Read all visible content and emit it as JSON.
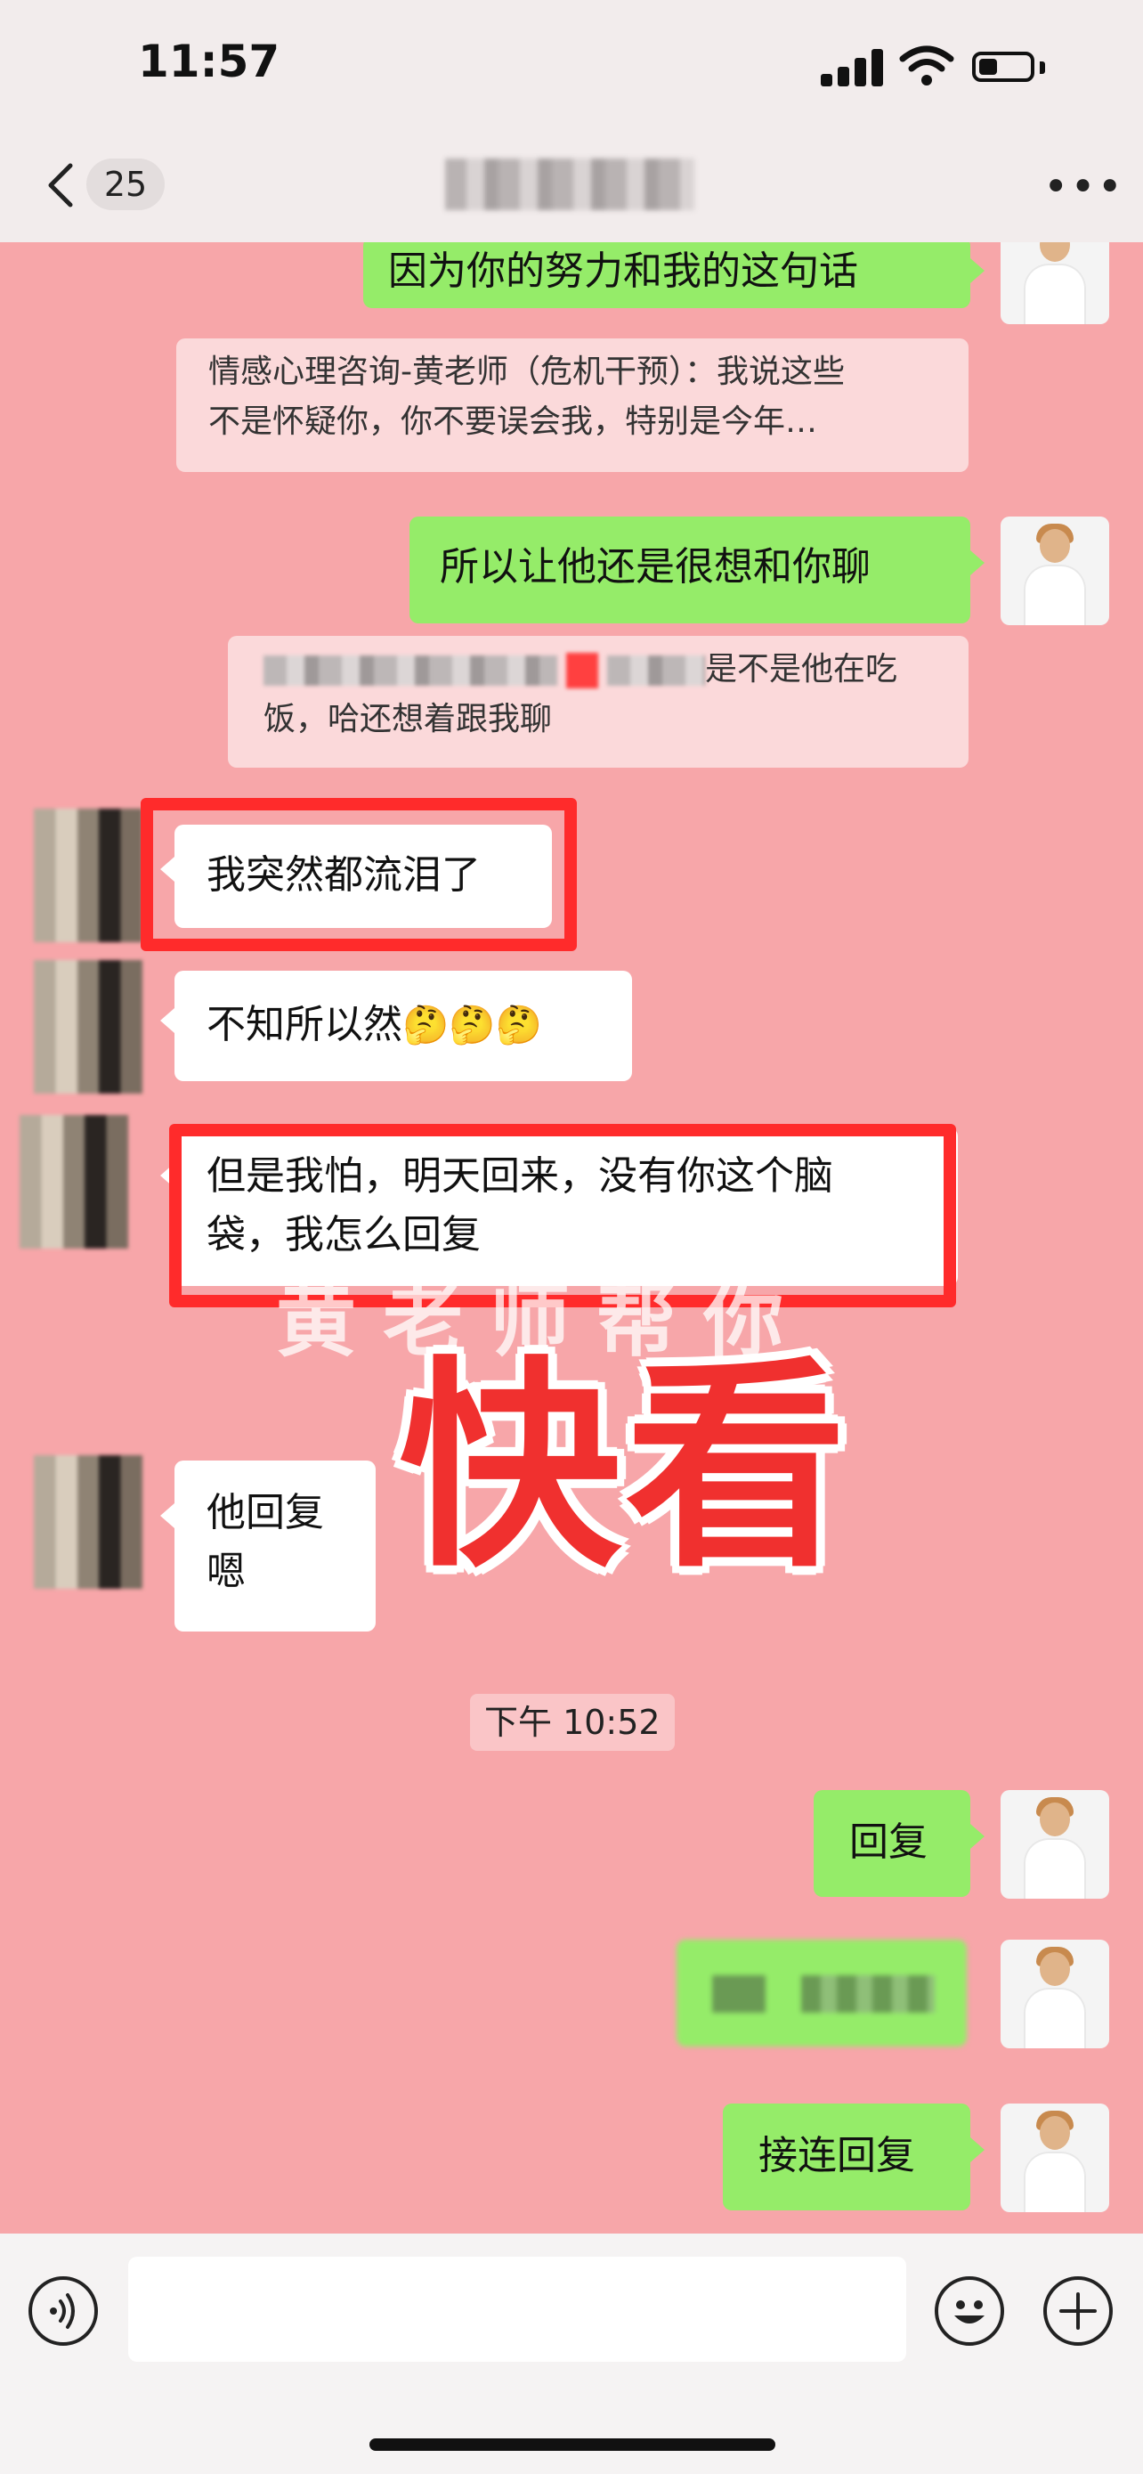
{
  "status_bar": {
    "time": "11:57"
  },
  "nav": {
    "unread_count": "25",
    "more": "•••"
  },
  "messages": {
    "m1": "因为你的努力和我的这句话",
    "q1_line1": "情感心理咨询-黄老师（危机干预）：我说这些",
    "q1_line2": "不是怀疑你，你不要误会我，特别是今年…",
    "m2": "所以让他还是很想和你聊",
    "q2_line1_tail": "是不是他在吃",
    "q2_line2": "饭，哈还想着跟我聊",
    "m3": "我突然都流泪了",
    "m4": "不知所以然",
    "m4_emoji": "🤔🤔🤔",
    "m5_line1": "但是我怕，明天回来，没有你这个脑",
    "m5_line2": "袋，我怎么回复",
    "m6_line1": "他回复",
    "m6_line2": "嗯",
    "timestamp": "下午 10:52",
    "m7": "回复",
    "m9": "接连回复"
  },
  "overlay": {
    "big_text": "快看",
    "watermark": "黄老师帮你"
  },
  "colors": {
    "chat_bg": "#f7a6a9",
    "green_bubble": "#95ec69",
    "highlight": "#ff2b2b",
    "overlay_red": "#f0302f"
  }
}
